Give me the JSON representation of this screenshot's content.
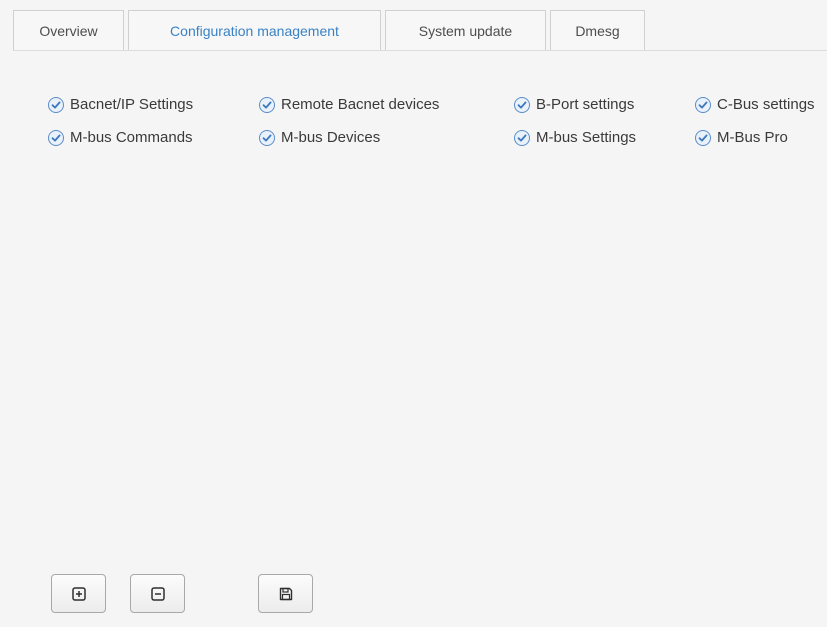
{
  "tabs": [
    {
      "label": "Overview",
      "active": false
    },
    {
      "label": "Configuration management",
      "active": true
    },
    {
      "label": "System update",
      "active": false
    },
    {
      "label": "Dmesg",
      "active": false
    }
  ],
  "options": [
    {
      "label": "Bacnet/IP Settings",
      "checked": true
    },
    {
      "label": "Remote Bacnet devices",
      "checked": true
    },
    {
      "label": "B-Port settings",
      "checked": true
    },
    {
      "label": "C-Bus settings",
      "checked": true
    },
    {
      "label": "M-bus Commands",
      "checked": true
    },
    {
      "label": "M-bus Devices",
      "checked": true
    },
    {
      "label": "M-bus Settings",
      "checked": true
    },
    {
      "label": "M-Bus Pro",
      "checked": true
    }
  ],
  "buttons": {
    "add_icon": "plus-square-icon",
    "remove_icon": "minus-square-icon",
    "save_icon": "floppy-disk-icon"
  },
  "colors": {
    "accent": "#3a82c4",
    "background": "#f5f5f5",
    "checkbox_border": "#5a8dc7"
  }
}
